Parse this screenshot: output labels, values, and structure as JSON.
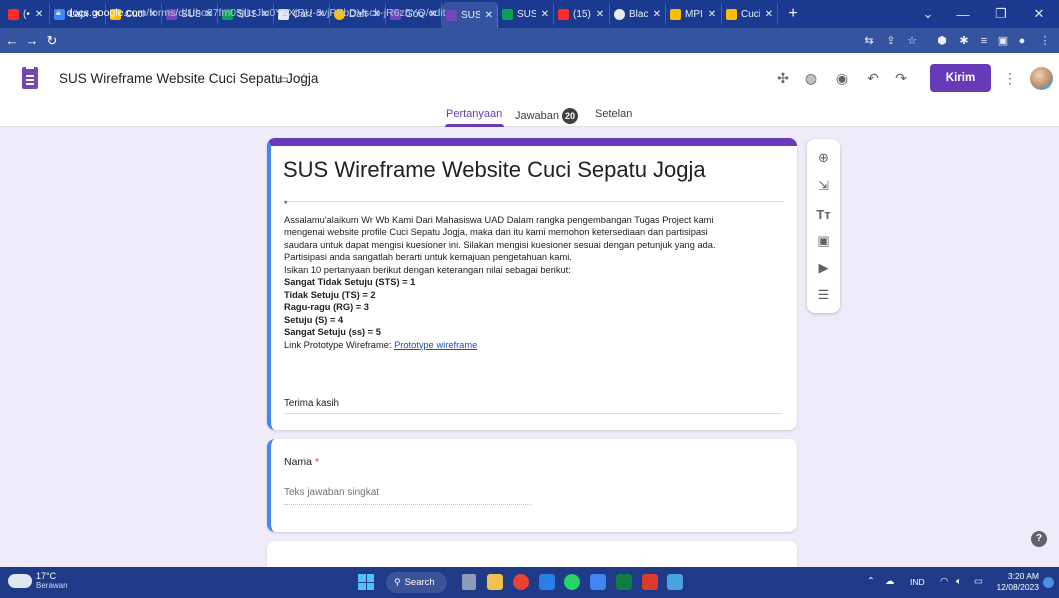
{
  "browser": {
    "tabs": [
      {
        "label": "(•",
        "favicon_color": "#ff2a2a"
      },
      {
        "label": "Lapo",
        "favicon_color": "#4285f4"
      },
      {
        "label": "Cuci",
        "favicon_color": "#fbbc04"
      },
      {
        "label": "SUS",
        "favicon_color": "#7248b9"
      },
      {
        "label": "SUS",
        "favicon_color": "#0f9d58"
      },
      {
        "label": "Cara",
        "favicon_color": "#e8eaed"
      },
      {
        "label": "Daft",
        "favicon_color": "#fbbc04"
      },
      {
        "label": "Goo",
        "favicon_color": "#7248b9"
      },
      {
        "label": "SUS",
        "favicon_color": "#7248b9",
        "active": true
      },
      {
        "label": "SUS",
        "favicon_color": "#0f9d58"
      },
      {
        "label": "(15)",
        "favicon_color": "#ff2a2a"
      },
      {
        "label": "Blac",
        "favicon_color": "#e8eaed"
      },
      {
        "label": "MPI",
        "favicon_color": "#fbbc04"
      },
      {
        "label": "Cuci",
        "favicon_color": "#fbbc04"
      }
    ],
    "new_tab": "+",
    "url_host": "docs.google.com",
    "url_path": "/forms/d/1lho87fm05jlLrJlu0Y2XjRU-8vjPXbDVscb-jR6z5YQ/edit"
  },
  "forms_header": {
    "title": "SUS Wireframe Website Cuci Sepatu Jogja",
    "send_label": "Kirim",
    "accent_color": "#673ab7"
  },
  "form_tabs": {
    "questions": "Pertanyaan",
    "responses": "Jawaban",
    "responses_count": "20",
    "settings": "Setelan"
  },
  "form": {
    "title": "SUS Wireframe Website Cuci Sepatu Jogja",
    "asterisk": "*",
    "description_lines": [
      "Assalamu'alaikum Wr Wb Kami Dari Mahasiswa UAD Dalam rangka pengembangan Tugas Project kami",
      "mengenai website profile Cuci Sepatu Jogja, maka dari itu kami memohon ketersediaan dan partisipasi",
      "saudara untuk dapat mengisi kuesioner ini. Silakan mengisi kuesioner sesuai dengan petunjuk yang ada.",
      "Partisipasi anda sangatlah berarti untuk kemajuan pengetahuan kami.",
      "Isikan 10 pertanyaan berikut dengan keterangan nilai sebagai berikut:"
    ],
    "scale": [
      "Sangat Tidak Setuju (STS) = 1",
      "Tidak Setuju (TS) = 2",
      "Ragu-ragu (RG) = 3",
      "Setuju (S) = 4",
      "Sangat Setuju (ss) = 5"
    ],
    "link_prefix": "Link Prototype Wireframe: ",
    "link_text": "Prototype wireframe",
    "closing": "Terima kasih"
  },
  "question": {
    "label": "Nama",
    "required_mark": "*",
    "placeholder": "Teks jawaban singkat"
  },
  "taskbar": {
    "temperature": "17°C",
    "condition": "Berawan",
    "search_label": "Search",
    "language": "IND",
    "time": "3:20 AM",
    "date": "12/08/2023"
  }
}
